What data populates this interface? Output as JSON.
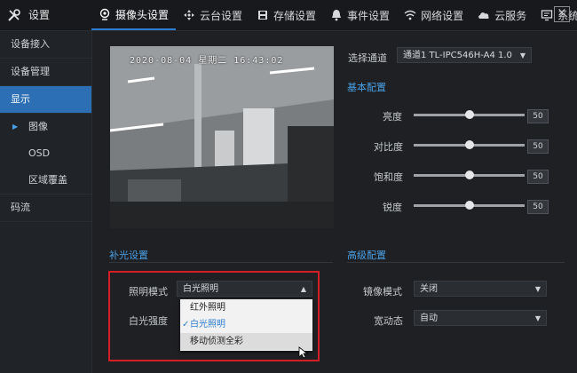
{
  "header": {
    "title": "设置",
    "tabs": [
      {
        "label": "摄像头设置",
        "icon": "camera-icon"
      },
      {
        "label": "云台设置",
        "icon": "ptz-icon"
      },
      {
        "label": "存储设置",
        "icon": "storage-icon"
      },
      {
        "label": "事件设置",
        "icon": "bell-icon"
      },
      {
        "label": "网络设置",
        "icon": "wifi-icon"
      },
      {
        "label": "云服务",
        "icon": "cloud-icon"
      },
      {
        "label": "系统设置",
        "icon": "system-icon"
      }
    ]
  },
  "sidebar": {
    "items": [
      {
        "label": "设备接入"
      },
      {
        "label": "设备管理"
      },
      {
        "label": "显示"
      },
      {
        "label": "图像"
      },
      {
        "label": "OSD"
      },
      {
        "label": "区域覆盖"
      },
      {
        "label": "码流"
      }
    ]
  },
  "video": {
    "timestamp": "2020-08-04 星期二 16:43:02"
  },
  "channel": {
    "label": "选择通道",
    "value": "通道1 TL-IPC546H-A4 1.0"
  },
  "basic": {
    "title": "基本配置",
    "sliders": [
      {
        "label": "亮度",
        "value": 50
      },
      {
        "label": "对比度",
        "value": 50
      },
      {
        "label": "饱和度",
        "value": 50
      },
      {
        "label": "锐度",
        "value": 50
      }
    ]
  },
  "fill_light": {
    "title": "补光设置",
    "mode_label": "照明模式",
    "mode_value": "白光照明",
    "intensity_label": "白光强度",
    "options": [
      "红外照明",
      "白光照明",
      "移动侦测全彩"
    ]
  },
  "advanced": {
    "title": "高级配置",
    "mirror_label": "镜像模式",
    "mirror_value": "关闭",
    "wdr_label": "宽动态",
    "wdr_value": "自动"
  },
  "colors": {
    "accent": "#2d7dd2",
    "highlight": "#d11f25",
    "sidebar_active": "#2d6fb5"
  }
}
